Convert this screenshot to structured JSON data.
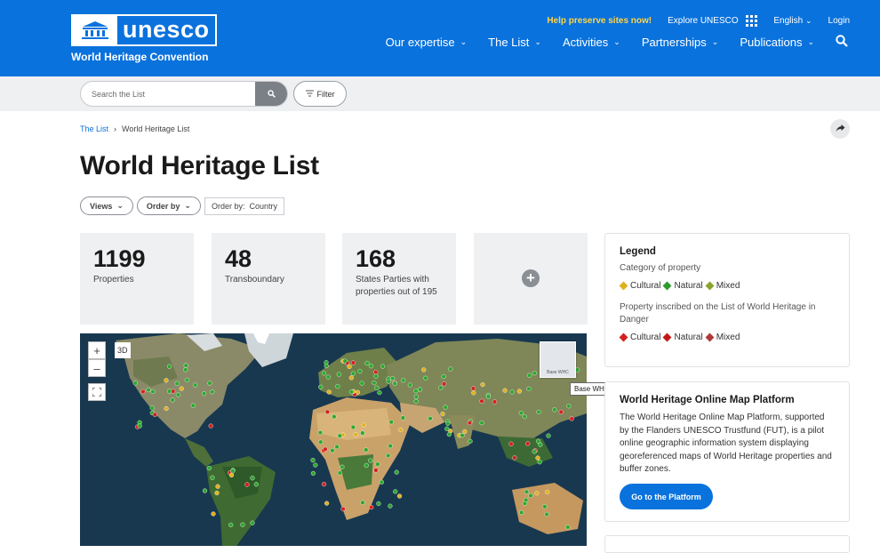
{
  "header": {
    "logo_text": "unesco",
    "logo_subtitle": "World Heritage Convention",
    "top_links": {
      "preserve": "Help preserve sites now!",
      "explore": "Explore UNESCO",
      "language": "English",
      "login": "Login"
    },
    "nav": [
      {
        "label": "Our expertise"
      },
      {
        "label": "The List"
      },
      {
        "label": "Activities"
      },
      {
        "label": "Partnerships"
      },
      {
        "label": "Publications"
      }
    ],
    "colors": {
      "brand": "#0a72dc",
      "highlight": "#ffd54a"
    }
  },
  "search": {
    "placeholder": "Search the List",
    "filter_label": "Filter"
  },
  "breadcrumb": {
    "root": "The List",
    "separator": "›",
    "current": "World Heritage List"
  },
  "page_title": "World Heritage List",
  "controls": {
    "views_label": "Views",
    "order_by_label": "Order by",
    "order_prefix": "Order by:",
    "order_value": "Country"
  },
  "stats": [
    {
      "value": "1199",
      "label": "Properties"
    },
    {
      "value": "48",
      "label": "Transboundary"
    },
    {
      "value": "168",
      "label": "States Parties with properties out of 195"
    }
  ],
  "stats_add_label": "+",
  "map": {
    "view_mode_label": "3D",
    "zoom_in": "+",
    "zoom_out": "–",
    "basemap_thumb_label": "Base WHC",
    "basemap_tooltip": "Base WHC"
  },
  "legend": {
    "title": "Legend",
    "category_heading": "Category of property",
    "categories": [
      {
        "label": "Cultural",
        "color": "#e0b020"
      },
      {
        "label": "Natural",
        "color": "#2e9a2e"
      },
      {
        "label": "Mixed",
        "color": "#8aa52a"
      }
    ],
    "danger_heading": "Property inscribed on the List of World Heritage in Danger",
    "danger_categories": [
      {
        "label": "Cultural",
        "color": "#d42020"
      },
      {
        "label": "Natural",
        "color": "#c41818"
      },
      {
        "label": "Mixed",
        "color": "#b03838"
      }
    ]
  },
  "platform": {
    "title": "World Heritage Online Map Platform",
    "description": "The World Heritage Online Map Platform, supported by the Flanders UNESCO Trustfund (FUT), is a pilot online geographic information system displaying georeferenced maps of World Heritage properties and buffer zones.",
    "button_label": "Go to the Platform"
  }
}
